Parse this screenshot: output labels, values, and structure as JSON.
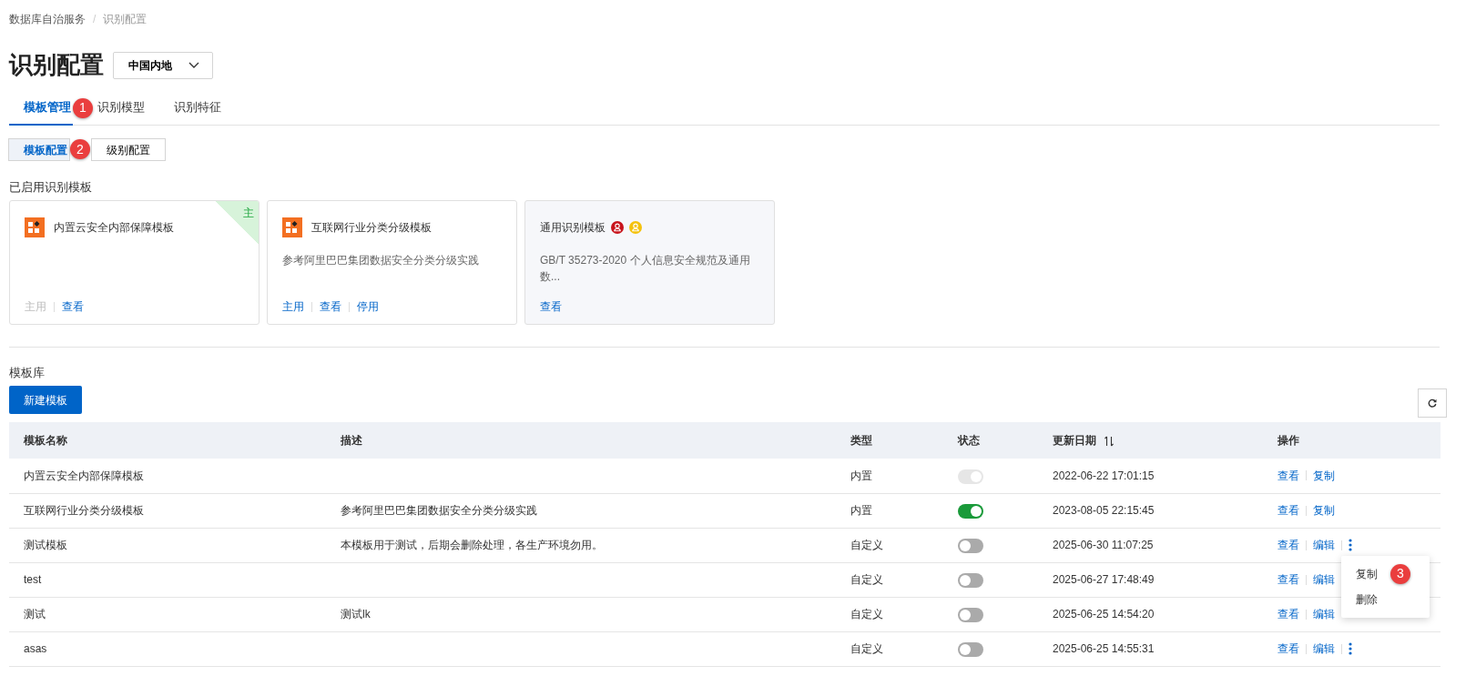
{
  "breadcrumb": [
    "数据库自治服务",
    "识别配置"
  ],
  "breadcrumb_separator": "/",
  "page_title": "识别配置",
  "region_select": {
    "value": "中国内地"
  },
  "tabs": [
    {
      "label": "模板管理",
      "selected": true
    },
    {
      "label": "识别模型",
      "selected": false
    },
    {
      "label": "识别特征",
      "selected": false
    }
  ],
  "sub_tabs": [
    {
      "label": "模板配置",
      "selected": true
    },
    {
      "label": "级别配置",
      "selected": false
    }
  ],
  "enabled_section": {
    "title": "已启用识别模板",
    "cards": [
      {
        "kind": "builtin",
        "title": "内置云安全内部保障模板",
        "primary_label": "主",
        "actions": [
          {
            "label": "主用",
            "disabled": true
          },
          {
            "label": "查看",
            "disabled": false
          }
        ]
      },
      {
        "kind": "builtin",
        "title": "互联网行业分类分级模板",
        "description": "参考阿里巴巴集团数据安全分类分级实践",
        "actions": [
          {
            "label": "主用",
            "disabled": false
          },
          {
            "label": "查看",
            "disabled": false
          },
          {
            "label": "停用",
            "disabled": false
          }
        ]
      },
      {
        "kind": "standard",
        "title": "通用识别模板",
        "description": "GB/T 35273-2020 个人信息安全规范及通用数...",
        "user_icons": [
          {
            "color": "#c8141c"
          },
          {
            "color": "#f4c20d"
          }
        ],
        "actions": [
          {
            "label": "查看",
            "disabled": false
          }
        ]
      }
    ]
  },
  "library": {
    "title": "模板库",
    "new_button": "新建模板",
    "columns": [
      "模板名称",
      "描述",
      "类型",
      "状态",
      "更新日期",
      "操作"
    ],
    "rows": [
      {
        "name": "内置云安全内部保障模板",
        "type": "内置",
        "on": true,
        "disabled": true,
        "date": "2022-06-22 17:01:15",
        "actions": [
          "查看",
          "复制"
        ],
        "more": false
      },
      {
        "name": "互联网行业分类分级模板",
        "description": "参考阿里巴巴集团数据安全分类分级实践",
        "type": "内置",
        "on": true,
        "disabled": false,
        "date": "2023-08-05 22:15:45",
        "actions": [
          "查看",
          "复制"
        ],
        "more": false
      },
      {
        "name": "测试模板",
        "description": "本模板用于测试，后期会删除处理，各生产环境勿用。",
        "type": "自定义",
        "on": false,
        "disabled": false,
        "date": "2025-06-30 11:07:25",
        "actions": [
          "查看",
          "编辑"
        ],
        "more": true,
        "menu": [
          "复制",
          "删除"
        ]
      },
      {
        "name": "test",
        "type": "自定义",
        "on": false,
        "disabled": false,
        "date": "2025-06-27 17:48:49",
        "actions": [
          "查看",
          "编辑"
        ],
        "more": false
      },
      {
        "name": "测试",
        "description": "测试lk",
        "type": "自定义",
        "on": false,
        "disabled": false,
        "date": "2025-06-25 14:54:20",
        "actions": [
          "查看",
          "编辑"
        ],
        "more": false
      },
      {
        "name": "asas",
        "type": "自定义",
        "on": false,
        "disabled": false,
        "date": "2025-06-25 14:55:31",
        "actions": [
          "查看",
          "编辑"
        ],
        "more": true
      }
    ]
  },
  "callouts": [
    "1",
    "2",
    "3"
  ]
}
